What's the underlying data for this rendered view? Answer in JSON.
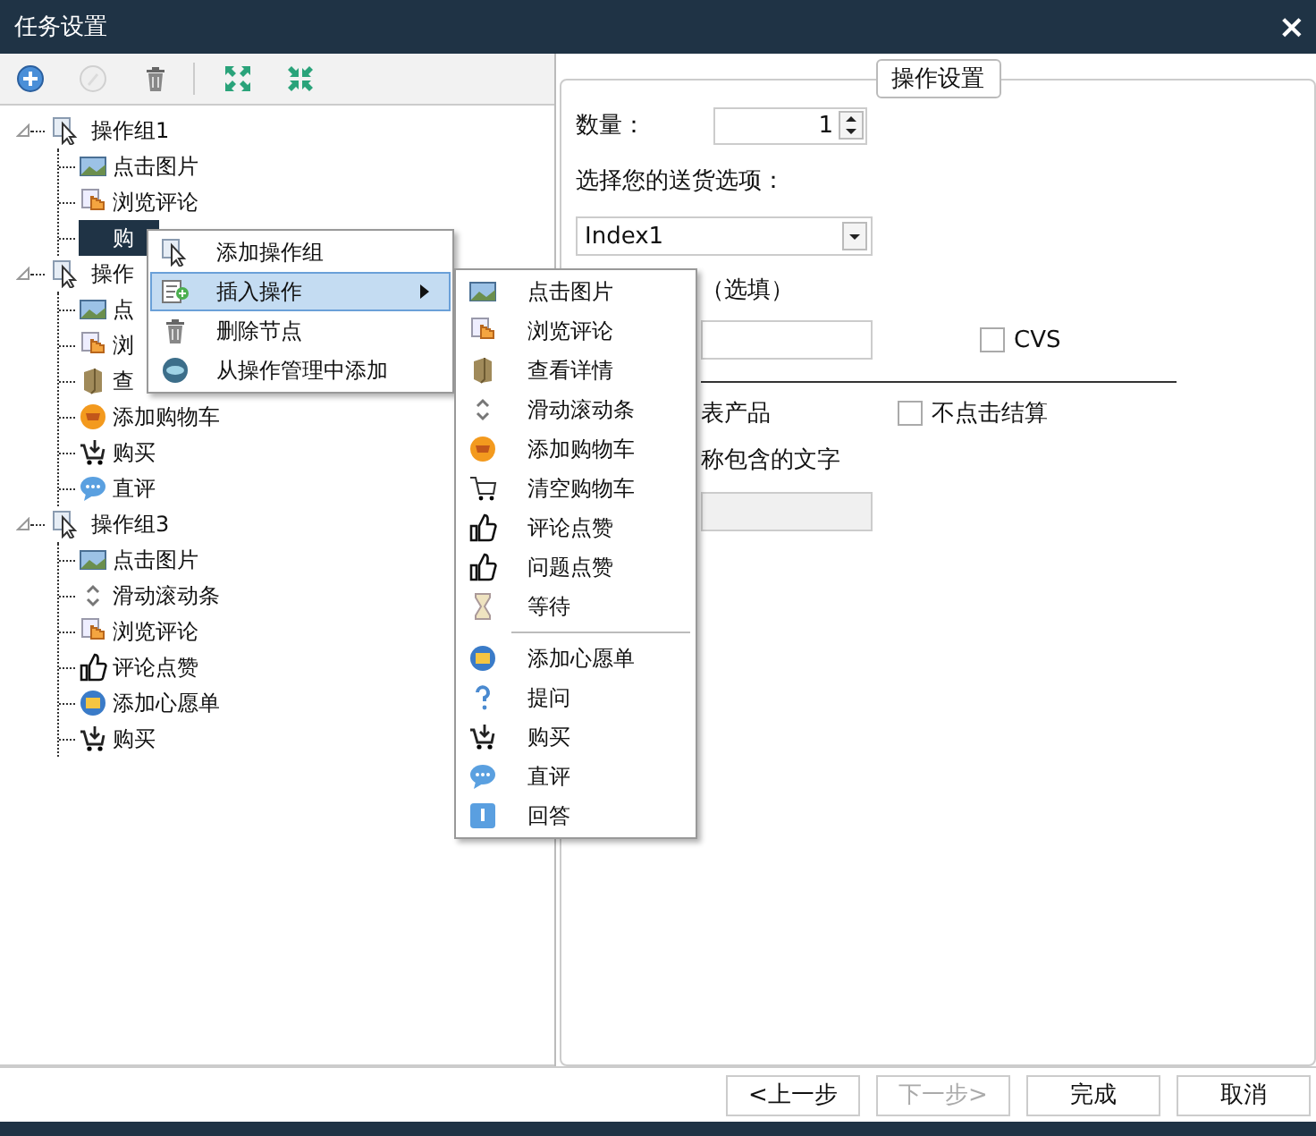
{
  "window": {
    "title": "任务设置",
    "close": "×"
  },
  "toolbar": [
    [
      {
        "kind": "add",
        "disabled": false
      },
      {
        "kind": "edit",
        "disabled": true
      },
      {
        "kind": "delete",
        "disabled": false
      }
    ],
    [
      {
        "kind": "expand",
        "disabled": false
      },
      {
        "kind": "collapse",
        "disabled": false
      }
    ]
  ],
  "tree": [
    {
      "label": "操作组1",
      "expanded": true,
      "children": [
        {
          "label": "点击图片",
          "kind": "image",
          "selected": false
        },
        {
          "label": "浏览评论",
          "kind": "hand",
          "selected": false
        },
        {
          "label": "购",
          "kind": "none",
          "selected": true
        }
      ]
    },
    {
      "label": "操作",
      "expanded": true,
      "children": [
        {
          "label": "点",
          "kind": "image",
          "selected": false
        },
        {
          "label": "浏",
          "kind": "hand",
          "selected": false
        },
        {
          "label": "查",
          "kind": "box",
          "selected": false
        },
        {
          "label": "添加购物车",
          "kind": "cartcoin",
          "selected": false
        },
        {
          "label": "购买",
          "kind": "buy",
          "selected": false
        },
        {
          "label": "直评",
          "kind": "comment",
          "selected": false
        }
      ]
    },
    {
      "label": "操作组3",
      "expanded": true,
      "children": [
        {
          "label": "点击图片",
          "kind": "image",
          "selected": false
        },
        {
          "label": "滑动滚动条",
          "kind": "scroll",
          "selected": false
        },
        {
          "label": "浏览评论",
          "kind": "hand",
          "selected": false
        },
        {
          "label": "评论点赞",
          "kind": "thumb",
          "selected": false
        },
        {
          "label": "添加心愿单",
          "kind": "wish",
          "selected": false
        },
        {
          "label": "购买",
          "kind": "buy",
          "selected": false
        }
      ]
    }
  ],
  "context_menu": {
    "items": [
      {
        "label": "添加操作组",
        "kind": "cursor",
        "selected": false,
        "submenu": false
      },
      {
        "label": "插入操作",
        "kind": "insert",
        "selected": true,
        "submenu": true
      },
      {
        "label": "删除节点",
        "kind": "trash",
        "selected": false,
        "submenu": false
      },
      {
        "label": "从操作管理中添加",
        "kind": "disc",
        "selected": false,
        "submenu": false
      }
    ]
  },
  "submenu": {
    "groups": [
      [
        {
          "label": "点击图片",
          "kind": "image"
        },
        {
          "label": "浏览评论",
          "kind": "hand"
        },
        {
          "label": "查看详情",
          "kind": "box"
        },
        {
          "label": "滑动滚动条",
          "kind": "scroll"
        },
        {
          "label": "添加购物车",
          "kind": "cartcoin"
        },
        {
          "label": "清空购物车",
          "kind": "cart"
        },
        {
          "label": "评论点赞",
          "kind": "thumb"
        },
        {
          "label": "问题点赞",
          "kind": "thumb"
        },
        {
          "label": "等待",
          "kind": "hourglass"
        }
      ],
      [
        {
          "label": "添加心愿单",
          "kind": "wish"
        },
        {
          "label": "提问",
          "kind": "question"
        },
        {
          "label": "购买",
          "kind": "buy"
        },
        {
          "label": "直评",
          "kind": "comment"
        },
        {
          "label": "回答",
          "kind": "answer"
        }
      ]
    ]
  },
  "settings": {
    "legend": "操作设置",
    "quantity_label": "数量：",
    "quantity": "1",
    "delivery_label": "选择您的送货选项：",
    "delivery": "Index1",
    "optional_label": "（选填）",
    "cvs": {
      "label": "CVS",
      "checked": false
    },
    "product_label": "表产品",
    "no_checkout": {
      "label": "不点击结算",
      "checked": false
    },
    "name_text_label": "称包含的文字",
    "name_field": {
      "disabled": true
    }
  },
  "footer": [
    {
      "label": "<上一步",
      "disabled": false
    },
    {
      "label": "下一步>",
      "disabled": true
    },
    {
      "label": "完成",
      "disabled": false
    },
    {
      "label": "取消",
      "disabled": false
    }
  ]
}
